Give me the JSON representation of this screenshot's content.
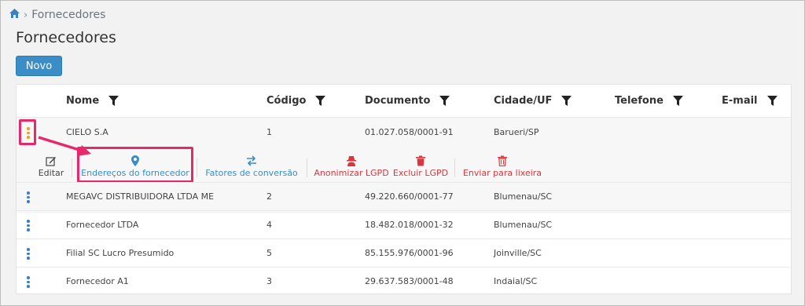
{
  "breadcrumb": {
    "home_icon": "home-icon",
    "current": "Fornecedores"
  },
  "page": {
    "title": "Fornecedores"
  },
  "toolbar": {
    "new_label": "Novo"
  },
  "table": {
    "columns": [
      "Nome",
      "Código",
      "Documento",
      "Cidade/UF",
      "Telefone",
      "E-mail"
    ],
    "rows": [
      {
        "nome": "CIELO S.A",
        "codigo": "1",
        "documento": "01.027.058/0001-91",
        "cidade": "Barueri/SP",
        "telefone": "",
        "email": ""
      },
      {
        "nome": "MEGAVC DISTRIBUIDORA LTDA ME",
        "codigo": "2",
        "documento": "49.220.660/0001-77",
        "cidade": "Blumenau/SC",
        "telefone": "",
        "email": ""
      },
      {
        "nome": "Fornecedor LTDA",
        "codigo": "4",
        "documento": "18.482.018/0001-32",
        "cidade": "Blumenau/SC",
        "telefone": "",
        "email": ""
      },
      {
        "nome": "Filial SC Lucro Presumido",
        "codigo": "5",
        "documento": "85.155.976/0001-96",
        "cidade": "Joinville/SC",
        "telefone": "",
        "email": ""
      },
      {
        "nome": "Fornecedor A1",
        "codigo": "3",
        "documento": "29.637.583/0001-48",
        "cidade": "Indaial/SC",
        "telefone": "",
        "email": ""
      }
    ]
  },
  "row_actions": {
    "edit": "Editar",
    "addresses": "Endereços do fornecedor",
    "conversion": "Fatores de conversão",
    "anonymize": "Anonimizar LGPD",
    "delete_lgpd": "Excluir LGPD",
    "trash": "Enviar para lixeira"
  },
  "colors": {
    "primary": "#3b8dc7",
    "danger": "#d9363e",
    "highlight": "#e8286b",
    "menu_accent": "#f0a020"
  }
}
